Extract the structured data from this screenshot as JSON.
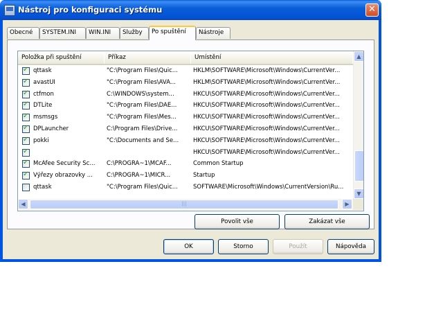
{
  "window": {
    "title": "Nástroj pro konfiguraci systému",
    "close_glyph": "✕"
  },
  "tabs": [
    {
      "label": "Obecné",
      "active": false
    },
    {
      "label": "SYSTEM.INI",
      "active": false
    },
    {
      "label": "WIN.INI",
      "active": false
    },
    {
      "label": "Služby",
      "active": false
    },
    {
      "label": "Po spuštění",
      "active": true
    },
    {
      "label": "Nástroje",
      "active": false
    }
  ],
  "startup_list": {
    "columns": [
      "Položka při spuštění",
      "Příkaz",
      "Umístění"
    ],
    "rows": [
      {
        "checked": true,
        "item": "qttask",
        "command": "\"C:\\Program Files\\Quic...",
        "location": "HKLM\\SOFTWARE\\Microsoft\\Windows\\CurrentVer..."
      },
      {
        "checked": true,
        "item": "avastUI",
        "command": "\"C:\\Program Files\\AVA...",
        "location": "HKLM\\SOFTWARE\\Microsoft\\Windows\\CurrentVer..."
      },
      {
        "checked": true,
        "item": "ctfmon",
        "command": "C:\\WINDOWS\\system...",
        "location": "HKCU\\SOFTWARE\\Microsoft\\Windows\\CurrentVer..."
      },
      {
        "checked": true,
        "item": "DTLite",
        "command": "\"C:\\Program Files\\DAE...",
        "location": "HKCU\\SOFTWARE\\Microsoft\\Windows\\CurrentVer..."
      },
      {
        "checked": true,
        "item": "msmsgs",
        "command": "\"C:\\Program Files\\Mes...",
        "location": "HKCU\\SOFTWARE\\Microsoft\\Windows\\CurrentVer..."
      },
      {
        "checked": true,
        "item": "DPLauncher",
        "command": "C:\\Program Files\\Drive...",
        "location": "HKCU\\SOFTWARE\\Microsoft\\Windows\\CurrentVer..."
      },
      {
        "checked": true,
        "item": "pokki",
        "command": "\"C:\\Documents and Se...",
        "location": "HKCU\\SOFTWARE\\Microsoft\\Windows\\CurrentVer..."
      },
      {
        "checked": true,
        "item": "",
        "command": "",
        "location": "HKCU\\SOFTWARE\\Microsoft\\Windows\\CurrentVer..."
      },
      {
        "checked": true,
        "item": "McAfee Security Sc...",
        "command": "C:\\PROGRA~1\\MCAF...",
        "location": "Common Startup"
      },
      {
        "checked": true,
        "item": "Výřezy obrazovky ...",
        "command": "C:\\PROGRA~1\\MICR...",
        "location": "Startup"
      },
      {
        "checked": false,
        "item": "qttask",
        "command": "\"C:\\Program Files\\Quic...",
        "location": "SOFTWARE\\Microsoft\\Windows\\CurrentVersion\\Ru..."
      }
    ]
  },
  "scrollbar": {
    "up_glyph": "▲",
    "down_glyph": "▼",
    "left_glyph": "◀",
    "right_glyph": "▶",
    "grip": "|||"
  },
  "panel_buttons": {
    "enable_all": "Povolit vše",
    "disable_all": "Zakázat vše"
  },
  "dialog_buttons": {
    "ok": "OK",
    "cancel": "Storno",
    "apply": "Použít",
    "help": "Nápověda"
  },
  "colors": {
    "titlebar": "#0a5fd8",
    "face": "#ece9d8",
    "check": "#21a121",
    "active_tab_accent": "#ffc83c"
  }
}
